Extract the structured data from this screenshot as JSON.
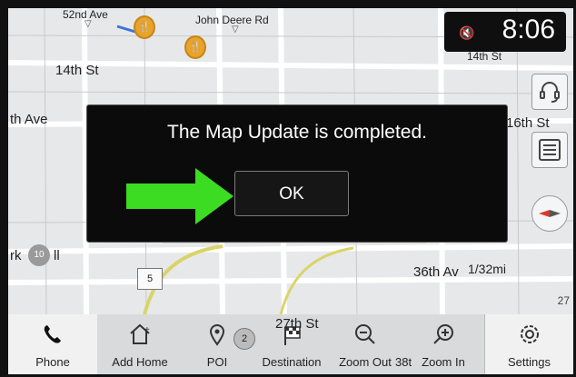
{
  "status": {
    "time": "8:06"
  },
  "map_labels": {
    "ave52": "52nd Ave",
    "john_deere": "John Deere Rd",
    "st14_left": "14th St",
    "st14_right": "14th St",
    "th_ave": "th Ave",
    "st16": "16th St",
    "rk": "rk",
    "ll": "ll",
    "ave36": "36th Av",
    "st27": "27th St",
    "scale": "1/32mi",
    "num27": "27",
    "num38": "38t",
    "route10": "10",
    "route5": "5",
    "poi_badge": "2"
  },
  "dialog": {
    "message": "The Map Update is completed.",
    "ok_label": "OK"
  },
  "bottom_nav": {
    "phone": "Phone",
    "add_home": "Add Home",
    "poi": "POI",
    "destination": "Destination",
    "zoom_out": "Zoom Out",
    "zoom_in": "Zoom In",
    "settings": "Settings"
  },
  "colors": {
    "arrow": "#3bdc22",
    "pin": "#e7a32a",
    "dialog_bg": "#0b0b0b"
  },
  "icons": [
    "phone-icon",
    "add-home-icon",
    "poi-icon",
    "destination-icon",
    "zoom-out-icon",
    "zoom-in-icon",
    "settings-icon",
    "voice-icon",
    "list-icon",
    "compass-icon",
    "mute-icon"
  ]
}
